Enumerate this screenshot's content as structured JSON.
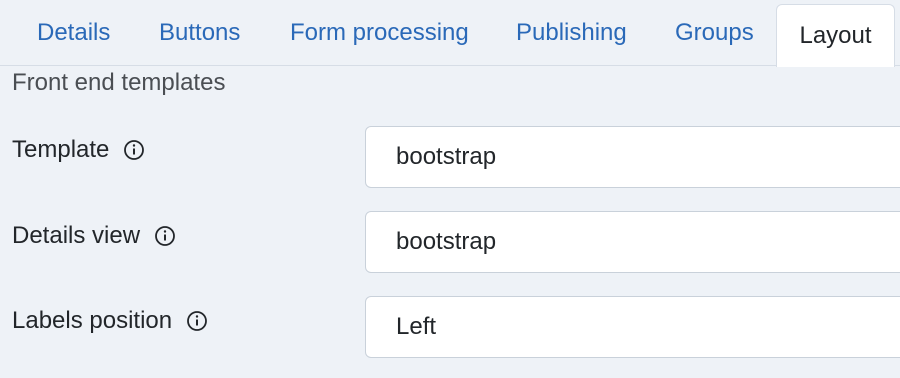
{
  "tabs": [
    {
      "label": "Details",
      "active": false
    },
    {
      "label": "Buttons",
      "active": false
    },
    {
      "label": "Form processing",
      "active": false
    },
    {
      "label": "Publishing",
      "active": false
    },
    {
      "label": "Groups",
      "active": false
    },
    {
      "label": "Layout",
      "active": true
    }
  ],
  "section": {
    "title": "Front end templates"
  },
  "fields": {
    "template": {
      "label": "Template",
      "value": "bootstrap"
    },
    "details_view": {
      "label": "Details view",
      "value": "bootstrap"
    },
    "labels_position": {
      "label": "Labels position",
      "value": "Left"
    }
  },
  "colors": {
    "accent": "#2a69b8",
    "background": "#eef2f7"
  },
  "icons": {
    "field_help": "info-circle-icon"
  }
}
